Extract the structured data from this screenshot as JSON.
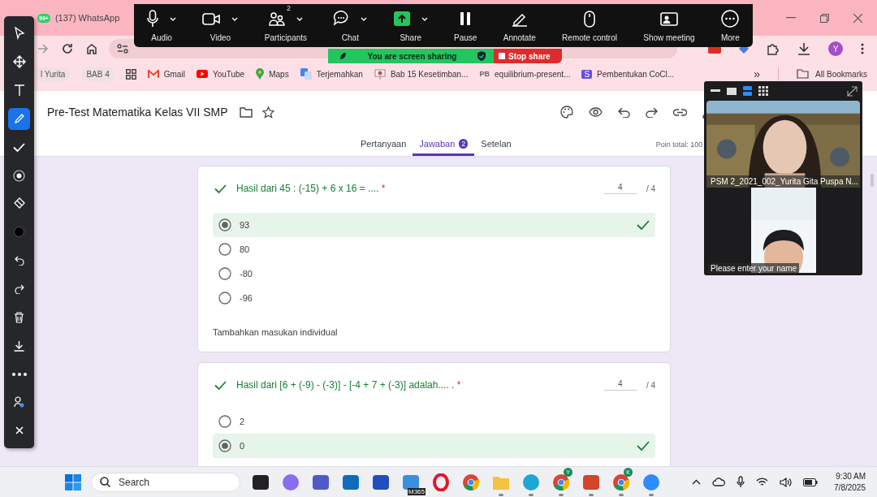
{
  "browser": {
    "tab": {
      "badge": "99+",
      "title": "(137) WhatsApp"
    },
    "avatar": "Y",
    "bookmarks": [
      {
        "kind": "chip",
        "label": "l Yurita"
      },
      {
        "kind": "chip",
        "label": "BAB 4"
      },
      {
        "kind": "apps"
      },
      {
        "kind": "gmail",
        "label": "Gmail"
      },
      {
        "kind": "youtube",
        "label": "YouTube"
      },
      {
        "kind": "maps",
        "label": "Maps"
      },
      {
        "kind": "translate",
        "label": "Terjemahkan"
      },
      {
        "kind": "slides",
        "label": "Bab 15 Kesetimban..."
      },
      {
        "kind": "logo",
        "logo": "PB",
        "label": "equilibrium-present..."
      },
      {
        "kind": "badge",
        "logo": "S",
        "label": "Pembentukan CoCl..."
      }
    ],
    "more": "»",
    "all_bookmarks": "All Bookmarks"
  },
  "form": {
    "title": "Pre-Test Matematika Kelas VII SMP",
    "tabs": [
      {
        "label": "Pertanyaan",
        "selected": false
      },
      {
        "label": "Jawaban",
        "selected": true,
        "badge": "2"
      },
      {
        "label": "Setelan",
        "selected": false
      }
    ],
    "total": "Poin total: 100",
    "questions": [
      {
        "text": "Hasil dari 45 : (-15) + 6 x 16 = ....",
        "required": "*",
        "correct": true,
        "score": "4",
        "max": "/ 4",
        "options": [
          {
            "label": "93",
            "selected": true,
            "correct": true
          },
          {
            "label": "80",
            "selected": false,
            "correct": false
          },
          {
            "label": "-80",
            "selected": false,
            "correct": false
          },
          {
            "label": "-96",
            "selected": false,
            "correct": false
          }
        ],
        "feedback": "Tambahkan masukan individual"
      },
      {
        "text": "Hasil dari [6 + (-9) - (-3)] - [-4 + 7 + (-3)] adalah.... .",
        "required": "*",
        "correct": true,
        "score": "4",
        "max": "/ 4",
        "options": [
          {
            "label": "2",
            "selected": false,
            "correct": false
          },
          {
            "label": "0",
            "selected": true,
            "correct": true
          }
        ]
      }
    ]
  },
  "zoom_toolbar": [
    {
      "kind": "audio",
      "label": "Audio",
      "caret": true
    },
    {
      "kind": "video",
      "label": "Video",
      "caret": true
    },
    {
      "kind": "participants",
      "label": "Participants",
      "caret": true,
      "badge": "2"
    },
    {
      "kind": "chat",
      "label": "Chat",
      "caret": true
    },
    {
      "kind": "share",
      "label": "Share",
      "caret": true
    },
    {
      "kind": "pause",
      "label": "Pause",
      "caret": false
    },
    {
      "kind": "annotate",
      "label": "Annotate",
      "caret": false
    },
    {
      "kind": "remote",
      "label": "Remote control",
      "caret": false
    },
    {
      "kind": "meeting",
      "label": "Show meeting",
      "caret": false
    },
    {
      "kind": "more",
      "label": "More",
      "caret": false
    }
  ],
  "share_banner": {
    "message": "You are screen sharing",
    "stop": "Stop share"
  },
  "annotation_tools": [
    {
      "kind": "pointer",
      "selected": false
    },
    {
      "kind": "move",
      "selected": false
    },
    {
      "kind": "text",
      "selected": false
    },
    {
      "kind": "pen",
      "selected": true
    },
    {
      "kind": "check",
      "selected": false
    },
    {
      "kind": "spotlight",
      "selected": false
    },
    {
      "kind": "eraser",
      "selected": false
    },
    {
      "kind": "color",
      "selected": false
    },
    {
      "kind": "undo",
      "selected": false
    },
    {
      "kind": "redo",
      "selected": false
    },
    {
      "kind": "delete",
      "selected": false
    },
    {
      "kind": "save",
      "selected": false
    },
    {
      "kind": "more",
      "selected": false
    },
    {
      "kind": "user",
      "selected": false
    },
    {
      "kind": "close",
      "selected": false
    }
  ],
  "video_panel": {
    "participants": [
      {
        "name": "PSM 2_2021_002_Yurita Gita Puspa N..."
      },
      {
        "name": "Please enter your name"
      }
    ]
  },
  "taskbar": {
    "search": "Search",
    "apps": [
      {
        "kind": "taskview",
        "running": false
      },
      {
        "kind": "copilot",
        "running": false
      },
      {
        "kind": "teams",
        "running": false
      },
      {
        "kind": "outlook",
        "running": false
      },
      {
        "kind": "blue",
        "running": false
      },
      {
        "kind": "m365",
        "running": false,
        "caption": "M365"
      },
      {
        "kind": "opera",
        "running": false
      },
      {
        "kind": "chrome",
        "running": false
      },
      {
        "kind": "folder",
        "running": true
      },
      {
        "kind": "edge",
        "running": true
      },
      {
        "kind": "chrome",
        "running": true,
        "badge": "Y"
      },
      {
        "kind": "powerpoint",
        "running": true
      },
      {
        "kind": "chrome",
        "running": true,
        "badge": "K"
      },
      {
        "kind": "zoom",
        "running": true
      }
    ],
    "time": "9:30 AM",
    "date": "7/8/2025"
  }
}
